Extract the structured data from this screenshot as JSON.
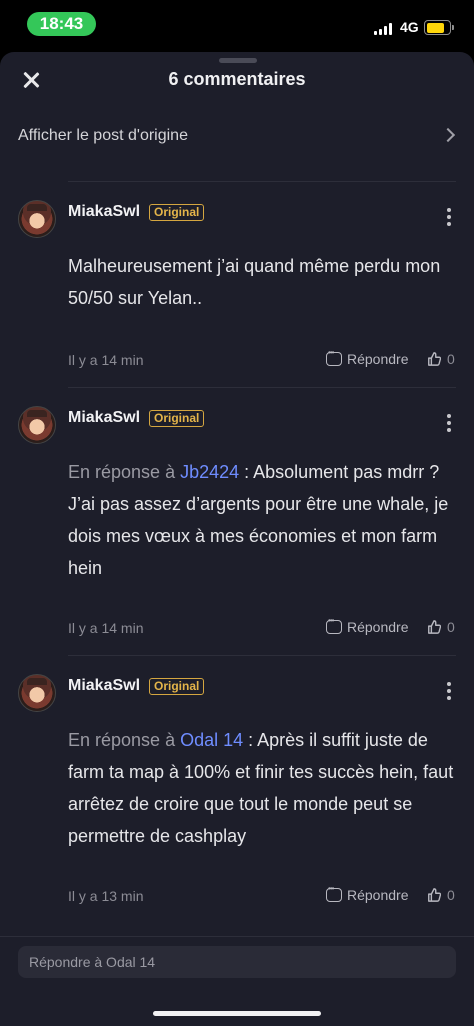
{
  "status": {
    "time": "18:43",
    "network": "4G"
  },
  "header": {
    "title": "6 commentaires"
  },
  "origin": {
    "label": "Afficher le post d'origine"
  },
  "comments": [
    {
      "author": "MiakaSwl",
      "badge": "Original",
      "reply_prefix": "",
      "mention": "",
      "text": "Malheureusement j’ai quand même perdu mon 50/50 sur Yelan..",
      "time": "Il y a 14 min",
      "reply_label": "Répondre",
      "likes": "0"
    },
    {
      "author": "MiakaSwl",
      "badge": "Original",
      "reply_prefix": "En réponse à ",
      "mention": "Jb2424",
      "text": " : Absolument pas mdrr ? J’ai pas assez d’argents pour être une whale, je dois mes vœux à mes économies et mon farm hein",
      "time": "Il y a 14 min",
      "reply_label": "Répondre",
      "likes": "0"
    },
    {
      "author": "MiakaSwl",
      "badge": "Original",
      "reply_prefix": "En réponse à ",
      "mention": "Odal 14",
      "text": " : Après il suffit juste de farm ta map à 100% et finir tes succès hein, faut arrêtez de croire que tout le monde peut se permettre de cashplay",
      "time": "Il y a 13 min",
      "reply_label": "Répondre",
      "likes": "0"
    }
  ],
  "reply_box": {
    "placeholder": "Répondre à Odal 14"
  },
  "colors": {
    "sheet": "#1d1e2a",
    "badge": "#e3b44a",
    "mention": "#6f8dff",
    "time_pill": "#34c759"
  }
}
